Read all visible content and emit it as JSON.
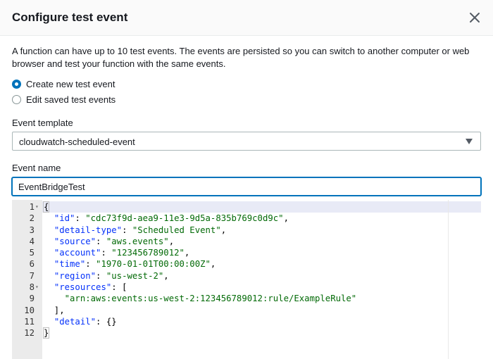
{
  "dialog": {
    "title": "Configure test event",
    "description": "A function can have up to 10 test events. The events are persisted so you can switch to another computer or web browser and test your function with the same events."
  },
  "options": [
    {
      "label": "Create new test event",
      "selected": true
    },
    {
      "label": "Edit saved test events",
      "selected": false
    }
  ],
  "template": {
    "label": "Event template",
    "value": "cloudwatch-scheduled-event"
  },
  "event_name": {
    "label": "Event name",
    "value": "EventBridgeTest"
  },
  "editor": {
    "lines": [
      {
        "num": "1",
        "fold": true,
        "tokens": [
          [
            "p",
            "{"
          ]
        ]
      },
      {
        "num": "2",
        "fold": false,
        "tokens": [
          [
            "p",
            "  "
          ],
          [
            "k",
            "\"id\""
          ],
          [
            "p",
            ": "
          ],
          [
            "s",
            "\"cdc73f9d-aea9-11e3-9d5a-835b769c0d9c\""
          ],
          [
            "p",
            ","
          ]
        ]
      },
      {
        "num": "3",
        "fold": false,
        "tokens": [
          [
            "p",
            "  "
          ],
          [
            "k",
            "\"detail-type\""
          ],
          [
            "p",
            ": "
          ],
          [
            "s",
            "\"Scheduled Event\""
          ],
          [
            "p",
            ","
          ]
        ]
      },
      {
        "num": "4",
        "fold": false,
        "tokens": [
          [
            "p",
            "  "
          ],
          [
            "k",
            "\"source\""
          ],
          [
            "p",
            ": "
          ],
          [
            "s",
            "\"aws.events\""
          ],
          [
            "p",
            ","
          ]
        ]
      },
      {
        "num": "5",
        "fold": false,
        "tokens": [
          [
            "p",
            "  "
          ],
          [
            "k",
            "\"account\""
          ],
          [
            "p",
            ": "
          ],
          [
            "s",
            "\"123456789012\""
          ],
          [
            "p",
            ","
          ]
        ]
      },
      {
        "num": "6",
        "fold": false,
        "tokens": [
          [
            "p",
            "  "
          ],
          [
            "k",
            "\"time\""
          ],
          [
            "p",
            ": "
          ],
          [
            "s",
            "\"1970-01-01T00:00:00Z\""
          ],
          [
            "p",
            ","
          ]
        ]
      },
      {
        "num": "7",
        "fold": false,
        "tokens": [
          [
            "p",
            "  "
          ],
          [
            "k",
            "\"region\""
          ],
          [
            "p",
            ": "
          ],
          [
            "s",
            "\"us-west-2\""
          ],
          [
            "p",
            ","
          ]
        ]
      },
      {
        "num": "8",
        "fold": true,
        "tokens": [
          [
            "p",
            "  "
          ],
          [
            "k",
            "\"resources\""
          ],
          [
            "p",
            ": ["
          ]
        ]
      },
      {
        "num": "9",
        "fold": false,
        "tokens": [
          [
            "p",
            "    "
          ],
          [
            "s",
            "\"arn:aws:events:us-west-2:123456789012:rule/ExampleRule\""
          ]
        ]
      },
      {
        "num": "10",
        "fold": false,
        "tokens": [
          [
            "p",
            "  ],"
          ]
        ]
      },
      {
        "num": "11",
        "fold": false,
        "tokens": [
          [
            "p",
            "  "
          ],
          [
            "k",
            "\"detail\""
          ],
          [
            "p",
            ": {}"
          ]
        ]
      },
      {
        "num": "12",
        "fold": false,
        "tokens": [
          [
            "p",
            "}"
          ]
        ]
      }
    ]
  },
  "colors": {
    "accent": "#0073bb",
    "json_key": "#0431fa",
    "json_string": "#036a07"
  },
  "icons": {
    "close": "close-icon",
    "select": "caret-down-icon",
    "fold": "fold-arrow-icon"
  }
}
